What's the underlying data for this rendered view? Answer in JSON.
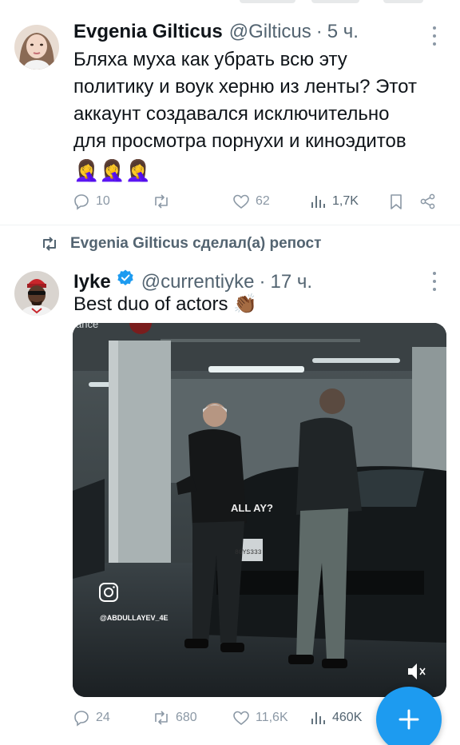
{
  "tweet1": {
    "author_name": "Evgenia Gilticus",
    "handle": "@Gilticus",
    "separator": "·",
    "time": "5 ч.",
    "text_lines": [
      "Бляха муха как убрать всю эту",
      "политику и воук херню из ленты? Этот",
      "аккаунт создавался исключительно",
      "для просмотра порнухи и киноэдитов"
    ],
    "emoji": "🤦‍♀️🤦‍♀️🤦‍♀️",
    "replies": "10",
    "retweets": "",
    "likes": "62",
    "views": "1,7K"
  },
  "repost_banner": "Evgenia Gilticus сделал(а) репост",
  "tweet2": {
    "author_name": "Iyke",
    "handle": "@currentiyke",
    "separator": "·",
    "time": "17 ч.",
    "text": "Best duo of actors",
    "emoji": "👏🏾",
    "media": {
      "watermark_top": "ance",
      "overlay_text": "ALL        AY?",
      "instagram_handle": "@ABDULLAYEV_4E",
      "plate": "8GYS333"
    },
    "replies": "24",
    "retweets": "680",
    "likes": "11,6K",
    "views": "460K"
  },
  "colors": {
    "accent": "#1d9bf0",
    "text_primary": "#0f1419",
    "text_secondary": "#536471",
    "icon_gray": "#8b98a5"
  },
  "icons": [
    "more-icon",
    "reply-icon",
    "retweet-icon",
    "like-icon",
    "views-icon",
    "bookmark-icon",
    "share-icon",
    "verified-icon",
    "instagram-icon",
    "mute-icon",
    "compose-plus-icon"
  ]
}
